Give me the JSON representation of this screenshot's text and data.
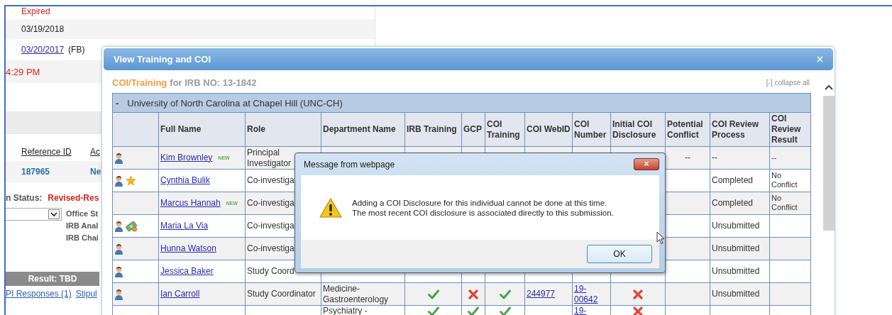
{
  "background_page": {
    "expired": "Expired",
    "date": "03/19/2018",
    "date_link": "03/20/2017",
    "date_note": "(FB)",
    "time": "4:29 PM",
    "list_columns": [
      "Reference ID",
      "Ac"
    ],
    "list_row": [
      "187965",
      "Ne"
    ],
    "status_label": "n Status:",
    "status_value": "Revised-Res",
    "assignments": [
      "Office St",
      "IRB Anal",
      "IRB Chai"
    ],
    "result_bar": "Result: TBD",
    "links": [
      "PI Responses (1)",
      "Stipul"
    ]
  },
  "modal": {
    "title": "View Training and COI",
    "close": "×",
    "heading_highlight": "COI/Training",
    "heading_rest": "for IRB NO: 13-1842",
    "collapse_all": "[-] collapse all",
    "table": {
      "group_toggle": "-",
      "group": "University of North Carolina at Chapel Hill (UNC-CH)",
      "columns": [
        "",
        "Full Name",
        "Role",
        "Department Name",
        "IRB Training",
        "GCP",
        "COI Training",
        "COI WebID",
        "COI Number",
        "Initial COI Disclosure",
        "Potential Conflict",
        "COI Review Process",
        "COI Review Result"
      ],
      "rows": [
        {
          "person_icon": true,
          "name": "Kim Brownley",
          "badge": "NEW",
          "role": "Principal Investigator",
          "potential_conflict": "--",
          "review_process": "--",
          "review_result": "--"
        },
        {
          "person_icon": true,
          "star_icon": true,
          "name": "Cynthia Bulik",
          "role": "Co-investiga",
          "review_process": "Completed",
          "review_result": "No Conflict"
        },
        {
          "name": "Marcus Hannah",
          "badge": "NEW",
          "role": "Co-investiga",
          "review_process": "Completed",
          "review_result": "No Conflict"
        },
        {
          "person_icon": true,
          "money_icon": true,
          "name": "Maria La Via",
          "role": "Co-investiga",
          "review_process": "Unsubmitted"
        },
        {
          "person_icon": true,
          "name": "Hunna Watson",
          "role": "Co-investiga",
          "review_process": "Unsubmitted"
        },
        {
          "person_icon": true,
          "name": "Jessica Baker",
          "role": "Study Coord",
          "review_process": "Unsubmitted"
        },
        {
          "person_icon": true,
          "name": "Ian Carroll",
          "role": "Study Coordinator",
          "department": "Medicine-Gastroenterology",
          "irb_training": true,
          "gcp": false,
          "coi_training": true,
          "coi_webid": "244977",
          "coi_number": "19-00642",
          "initial_disclosure": false,
          "review_process": "Unsubmitted"
        },
        {
          "department": "Psychiatry -",
          "irb_training": true,
          "gcp": true,
          "coi_training": true,
          "coi_number": "19-",
          "initial_disclosure": false
        }
      ]
    }
  },
  "dialog": {
    "title": "Message from webpage",
    "close": "×",
    "message_lines": [
      "Adding a COI Disclosure for this individual cannot be done at this time.",
      "The most recent COI disclosure is associated directly to this submission."
    ],
    "button": "OK"
  }
}
